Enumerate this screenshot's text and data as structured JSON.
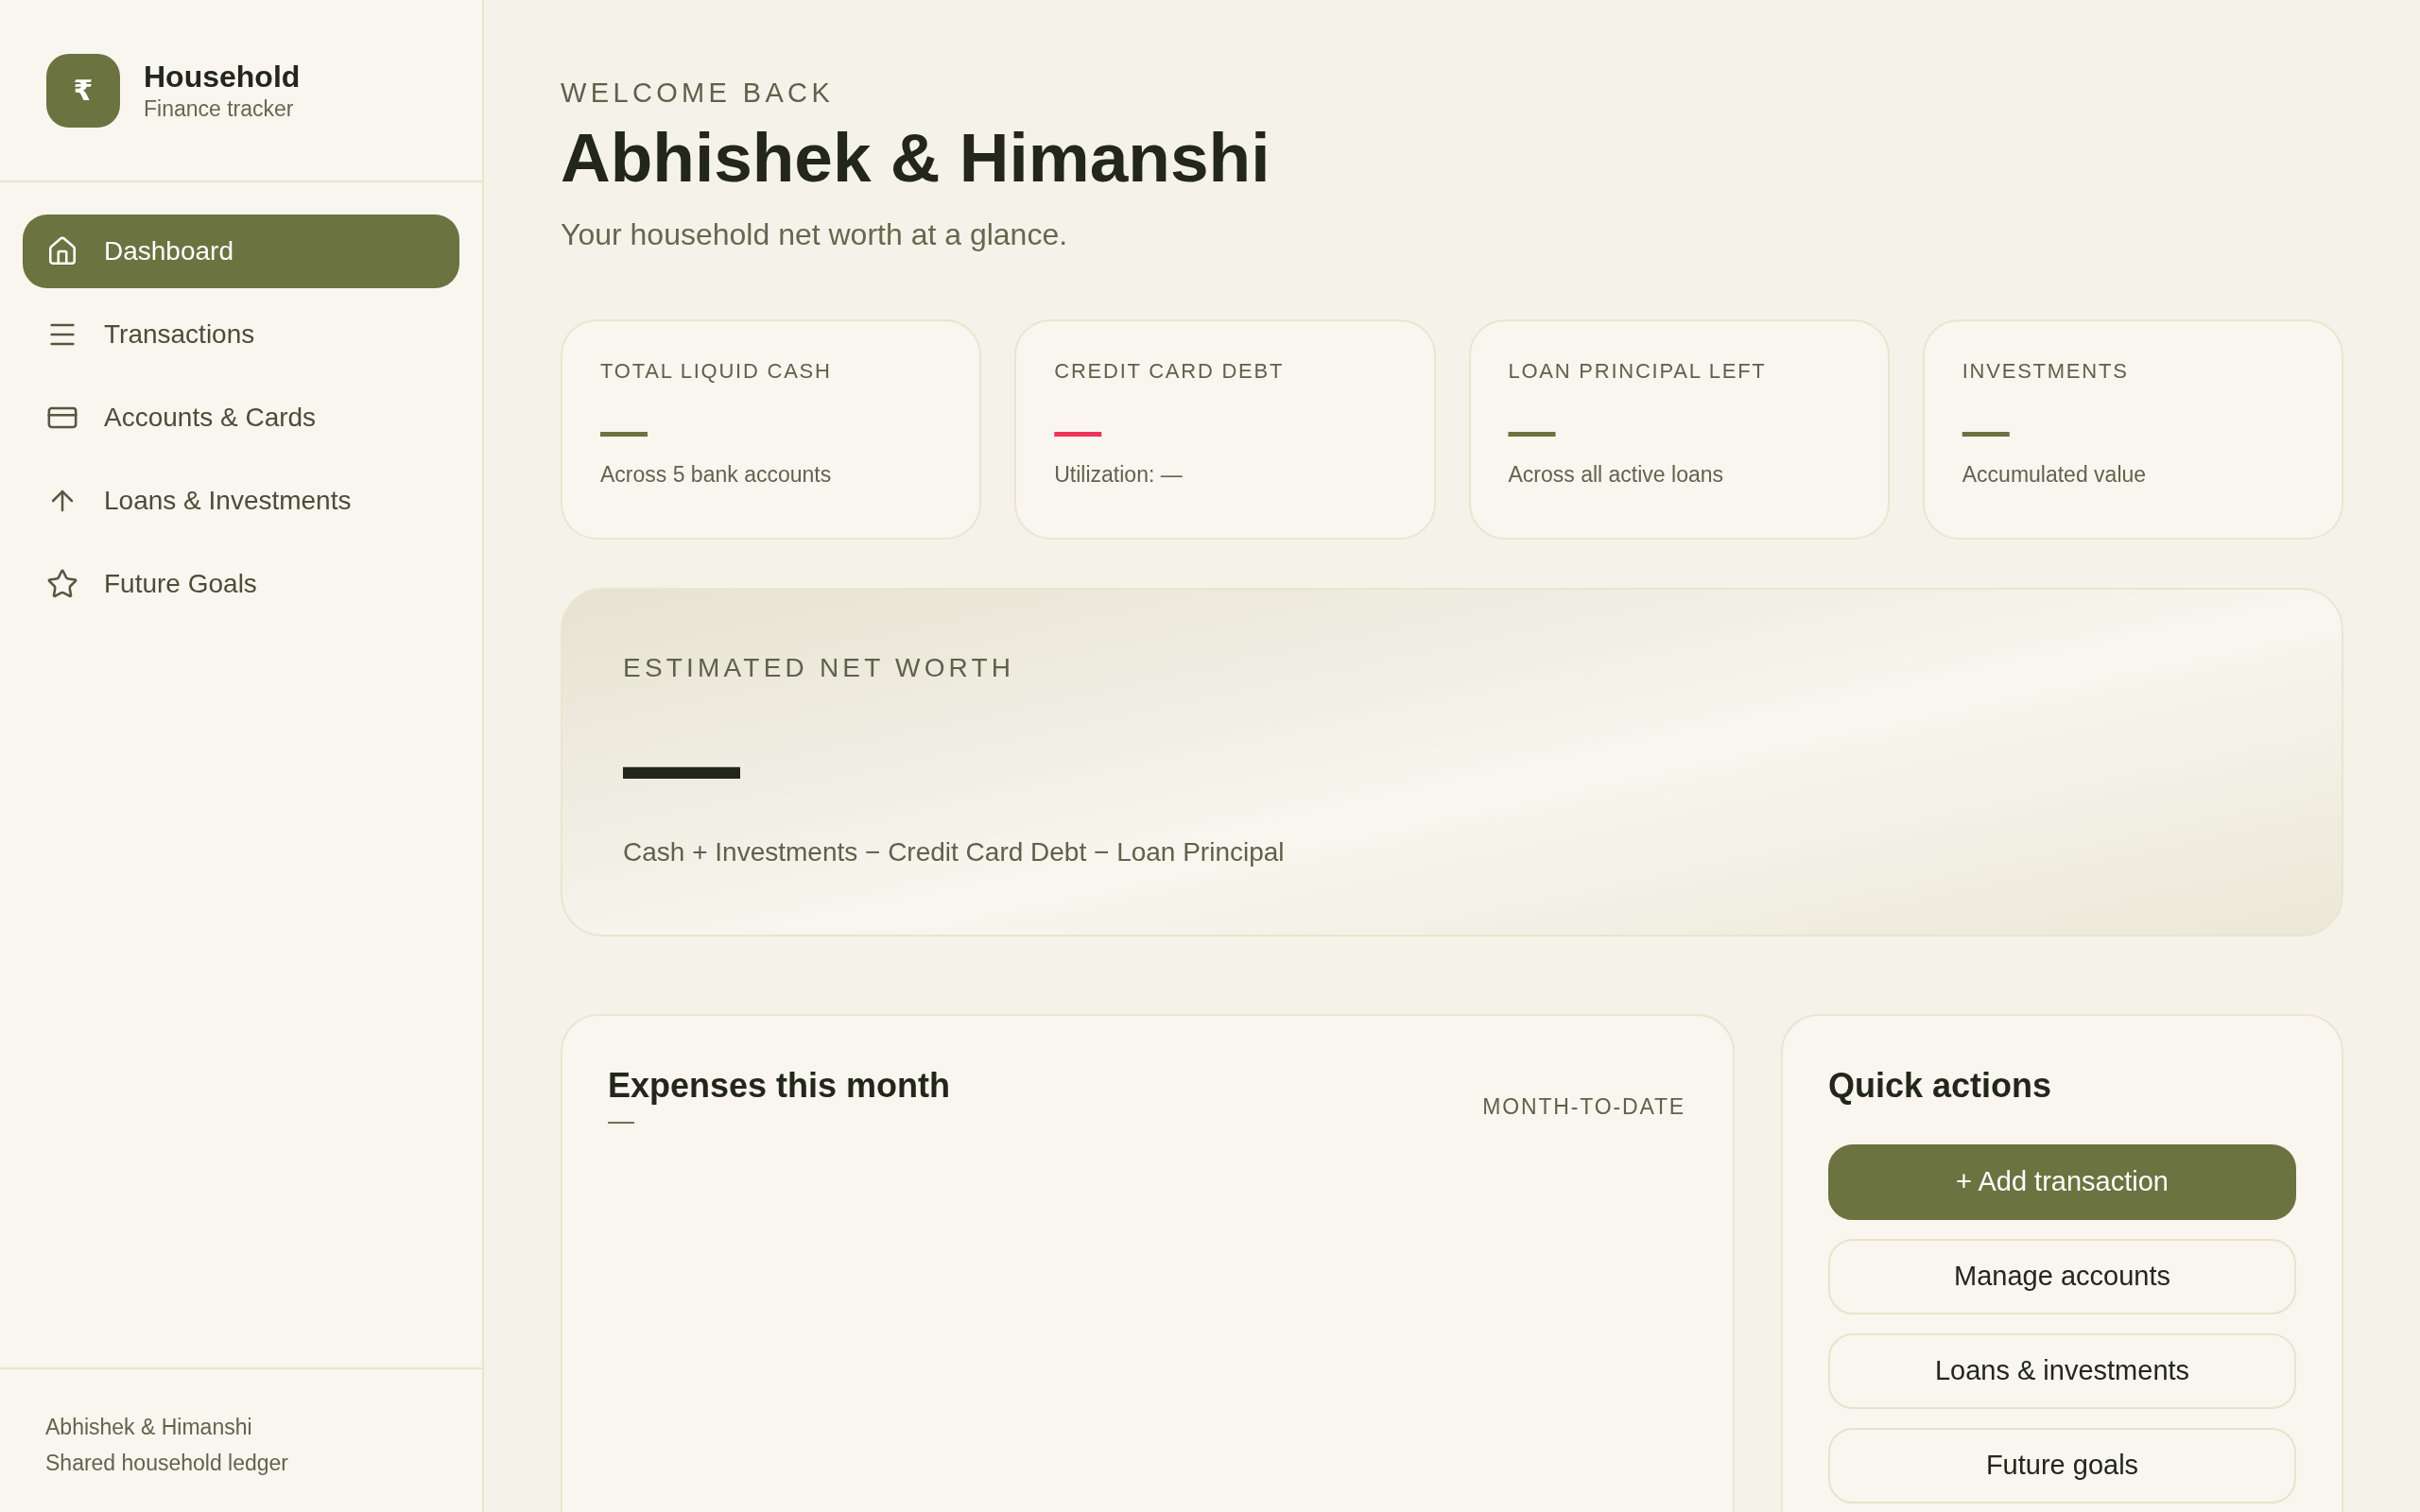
{
  "sidebar": {
    "brand": {
      "logo_symbol": "₹",
      "title": "Household",
      "subtitle": "Finance tracker"
    },
    "nav_items": [
      {
        "label": "Dashboard",
        "selected": true
      },
      {
        "label": "Transactions",
        "selected": false
      },
      {
        "label": "Accounts & Cards",
        "selected": false
      },
      {
        "label": "Loans & Investments",
        "selected": false
      },
      {
        "label": "Future Goals",
        "selected": false
      }
    ],
    "footer": {
      "name": "Abhishek & Himanshi",
      "caption": "Shared household ledger"
    }
  },
  "header": {
    "eyebrow": "WELCOME BACK",
    "title": "Abhishek & Himanshi",
    "subtitle": "Your household net worth at a glance."
  },
  "stat_cards": [
    {
      "label": "TOTAL LIQUID CASH",
      "value": "—",
      "color": "#6b7340",
      "caption": "Across 5 bank accounts"
    },
    {
      "label": "CREDIT CARD DEBT",
      "value": "—",
      "color": "#f0355b",
      "caption": "Utilization: —"
    },
    {
      "label": "LOAN PRINCIPAL LEFT",
      "value": "—",
      "color": "#6b7340",
      "caption": "Across all active loans"
    },
    {
      "label": "INVESTMENTS",
      "value": "—",
      "color": "#6b7340",
      "caption": "Accumulated value"
    }
  ],
  "net_worth": {
    "label": "ESTIMATED NET WORTH",
    "value": "—",
    "formula": "Cash + Investments − Credit Card Debt − Loan Principal"
  },
  "expenses": {
    "title": "Expenses this month",
    "value": "—",
    "period": "MONTH-TO-DATE"
  },
  "quick_actions": {
    "title": "Quick actions",
    "buttons": [
      {
        "label": "+ Add transaction",
        "kind": "primary"
      },
      {
        "label": "Manage accounts",
        "kind": "secondary"
      },
      {
        "label": "Loans & investments",
        "kind": "secondary"
      },
      {
        "label": "Future goals",
        "kind": "secondary"
      }
    ]
  }
}
